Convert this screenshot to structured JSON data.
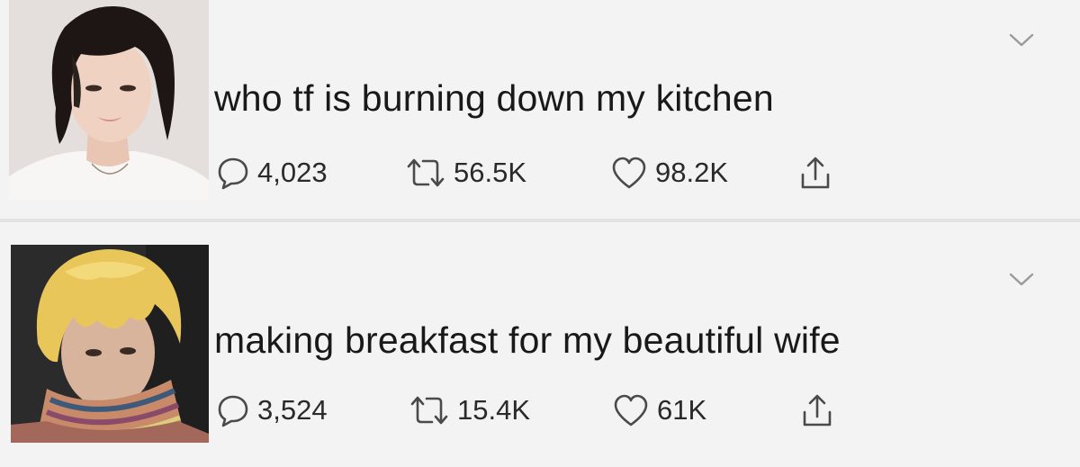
{
  "tweets": [
    {
      "avatar_icon": "profile-photo-dark-hair",
      "text": "who tf is burning down my kitchen",
      "replies": "4,023",
      "retweets": "56.5K",
      "likes": "98.2K"
    },
    {
      "avatar_icon": "profile-photo-blond-hair",
      "text": "making breakfast for my beautiful wife",
      "replies": "3,524",
      "retweets": "15.4K",
      "likes": "61K"
    }
  ],
  "icons": {
    "menu": "chevron-down-icon",
    "reply": "speech-bubble-icon",
    "retweet": "retweet-icon",
    "like": "heart-icon",
    "share": "share-icon"
  },
  "colors": {
    "background": "#f3f3f3",
    "text": "#1b1b1b",
    "icon": "#4a4a4a",
    "divider": "#e2e2e2"
  }
}
